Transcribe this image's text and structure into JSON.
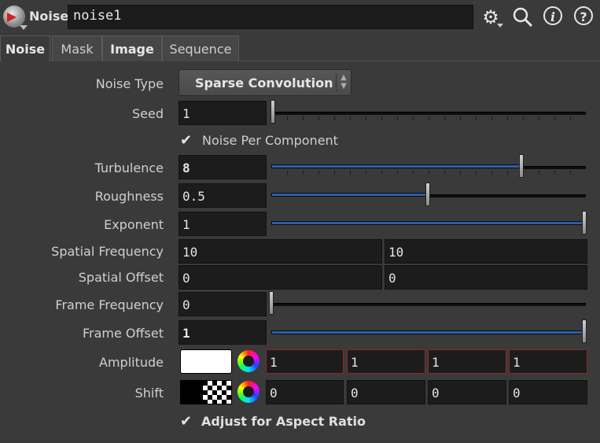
{
  "header": {
    "node_type": "Noise",
    "node_name": "noise1",
    "icons": [
      "gear-icon",
      "search-icon",
      "info-icon",
      "help-icon"
    ]
  },
  "tabs": [
    {
      "label": "Noise"
    },
    {
      "label": "Mask"
    },
    {
      "label": "Image"
    },
    {
      "label": "Sequence"
    }
  ],
  "params": {
    "noise_type": {
      "label": "Noise Type",
      "value": "Sparse Convolution"
    },
    "seed": {
      "label": "Seed",
      "value": "1"
    },
    "noise_per_component": {
      "label": "Noise Per Component",
      "checked": true
    },
    "turbulence": {
      "label": "Turbulence",
      "value": "8"
    },
    "roughness": {
      "label": "Roughness",
      "value": "0.5"
    },
    "exponent": {
      "label": "Exponent",
      "value": "1"
    },
    "spatial_frequency": {
      "label": "Spatial Frequency",
      "x": "10",
      "y": "10"
    },
    "spatial_offset": {
      "label": "Spatial Offset",
      "x": "0",
      "y": "0"
    },
    "frame_frequency": {
      "label": "Frame Frequency",
      "value": "0"
    },
    "frame_offset": {
      "label": "Frame Offset",
      "value": "1"
    },
    "amplitude": {
      "label": "Amplitude",
      "values": [
        "1",
        "1",
        "1",
        "1"
      ]
    },
    "shift": {
      "label": "Shift",
      "values": [
        "0",
        "0",
        "0",
        "0"
      ]
    },
    "adjust_aspect": {
      "label": "Adjust for Aspect Ratio",
      "checked": true
    }
  },
  "colors": {
    "slider_fill": "#2b5fa8",
    "field_bg": "#1c1c1c",
    "panel_bg": "#3a3a3a",
    "rgba_border": "#8a2a2a"
  }
}
